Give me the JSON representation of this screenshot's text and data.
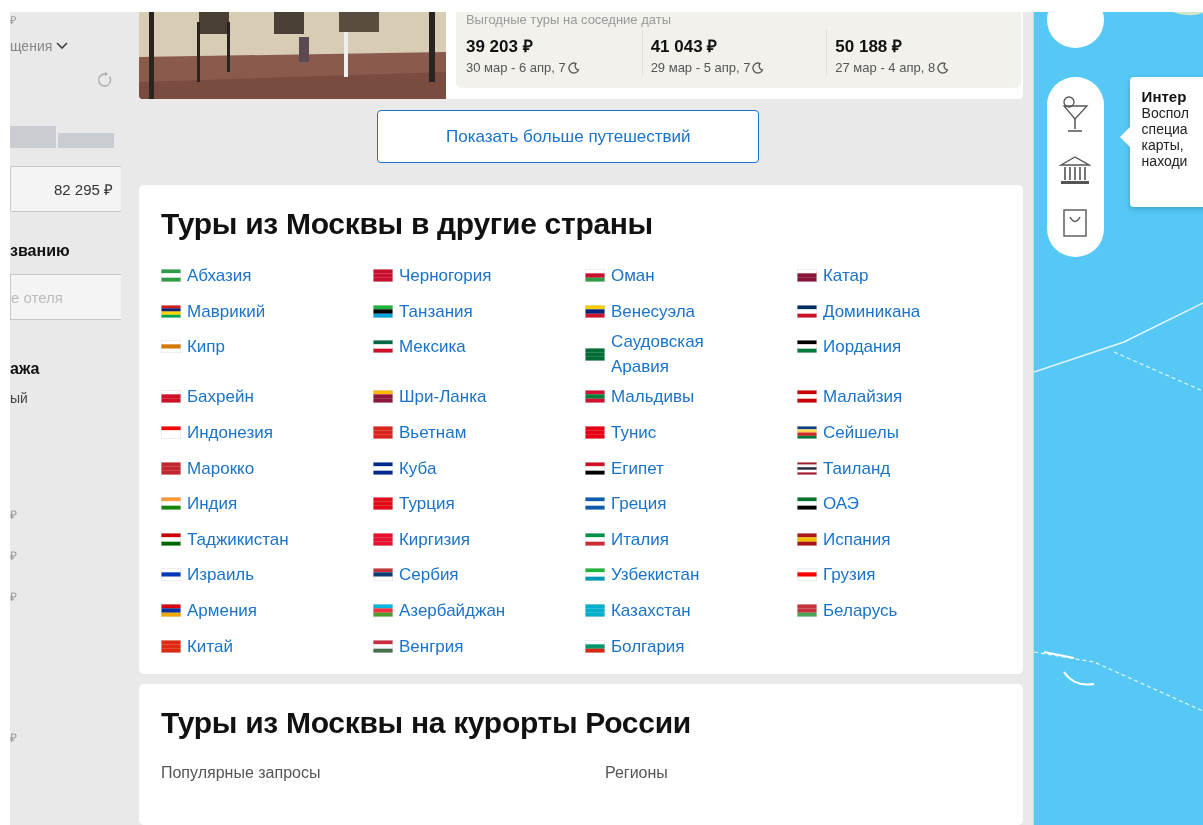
{
  "filters_sidebar": {
    "price_top": "₽",
    "sort_label": "щения",
    "price_field": {
      "value": "82 295 ₽"
    },
    "name_heading": "званию",
    "name_field": {
      "placeholder": "е отеля"
    },
    "beach_heading": "ажа",
    "beach_option": "ый",
    "price_fragments": [
      "₽",
      "₽",
      "₽",
      "₽"
    ]
  },
  "hotel_card": {
    "nearby_dates": {
      "title": "Выгодные туры на соседние даты",
      "offers": [
        {
          "price": "39 203 ₽",
          "dates": "30 мар - 6 апр, 7"
        },
        {
          "price": "41 043 ₽",
          "dates": "29 мар - 5 апр, 7"
        },
        {
          "price": "50 188 ₽",
          "dates": "27 мар - 4 апр, 8"
        }
      ]
    }
  },
  "show_more_button": "Показать больше путешествий",
  "countries_section": {
    "title": "Туры из Москвы в другие страны",
    "countries": [
      {
        "name": "Абхазия"
      },
      {
        "name": "Черногория"
      },
      {
        "name": "Оман"
      },
      {
        "name": "Катар"
      },
      {
        "name": "Маврикий"
      },
      {
        "name": "Танзания"
      },
      {
        "name": "Венесуэла"
      },
      {
        "name": "Доминикана"
      },
      {
        "name": "Кипр"
      },
      {
        "name": "Мексика"
      },
      {
        "name": "Саудовская Аравия"
      },
      {
        "name": "Иордания"
      },
      {
        "name": "Бахрейн"
      },
      {
        "name": "Шри-Ланка"
      },
      {
        "name": "Мальдивы"
      },
      {
        "name": "Малайзия"
      },
      {
        "name": "Индонезия"
      },
      {
        "name": "Вьетнам"
      },
      {
        "name": "Тунис"
      },
      {
        "name": "Сейшелы"
      },
      {
        "name": "Марокко"
      },
      {
        "name": "Куба"
      },
      {
        "name": "Египет"
      },
      {
        "name": "Таиланд"
      },
      {
        "name": "Индия"
      },
      {
        "name": "Турция"
      },
      {
        "name": "Греция"
      },
      {
        "name": "ОАЭ"
      },
      {
        "name": "Таджикистан"
      },
      {
        "name": "Киргизия"
      },
      {
        "name": "Италия"
      },
      {
        "name": "Испания"
      },
      {
        "name": "Израиль"
      },
      {
        "name": "Сербия"
      },
      {
        "name": "Узбекистан"
      },
      {
        "name": "Грузия"
      },
      {
        "name": "Армения"
      },
      {
        "name": "Азербайджан"
      },
      {
        "name": "Казахстан"
      },
      {
        "name": "Беларусь"
      },
      {
        "name": "Китай"
      },
      {
        "name": "Венгрия"
      },
      {
        "name": "Болгария"
      }
    ]
  },
  "russia_section": {
    "title": "Туры из Москвы на курорты России",
    "columns": [
      "Популярные запросы",
      "Регионы"
    ]
  },
  "map": {
    "tooltip": {
      "title": "Интер",
      "lines": [
        "Воспол",
        "специа",
        "карты,",
        "находи"
      ]
    }
  }
}
